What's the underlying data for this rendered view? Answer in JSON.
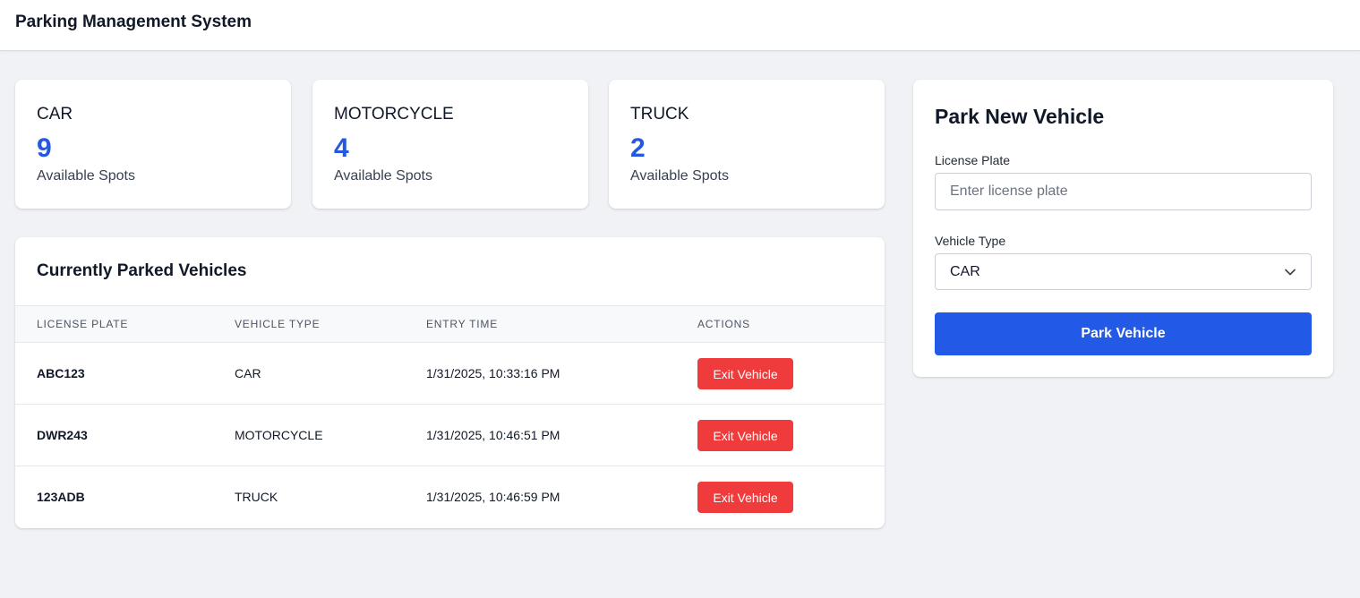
{
  "header": {
    "title": "Parking Management System"
  },
  "stats": [
    {
      "type": "CAR",
      "count": "9",
      "label": "Available Spots"
    },
    {
      "type": "MOTORCYCLE",
      "count": "4",
      "label": "Available Spots"
    },
    {
      "type": "TRUCK",
      "count": "2",
      "label": "Available Spots"
    }
  ],
  "parked": {
    "title": "Currently Parked Vehicles",
    "columns": [
      "License Plate",
      "Vehicle Type",
      "Entry Time",
      "Actions"
    ],
    "rows": [
      {
        "plate": "ABC123",
        "type": "CAR",
        "entry": "1/31/2025, 10:33:16 PM",
        "action": "Exit Vehicle"
      },
      {
        "plate": "DWR243",
        "type": "MOTORCYCLE",
        "entry": "1/31/2025, 10:46:51 PM",
        "action": "Exit Vehicle"
      },
      {
        "plate": "123ADB",
        "type": "TRUCK",
        "entry": "1/31/2025, 10:46:59 PM",
        "action": "Exit Vehicle"
      }
    ]
  },
  "form": {
    "title": "Park New Vehicle",
    "plate_label": "License Plate",
    "plate_value": "",
    "plate_placeholder": "Enter license plate",
    "type_label": "Vehicle Type",
    "type_selected": "CAR",
    "submit_label": "Park Vehicle"
  },
  "colors": {
    "accent": "#2259e6",
    "count": "#2458e0",
    "danger": "#ef3b3b",
    "background": "#f0f2f5"
  },
  "icons": {
    "select_chevron": "chevron-down-icon"
  }
}
